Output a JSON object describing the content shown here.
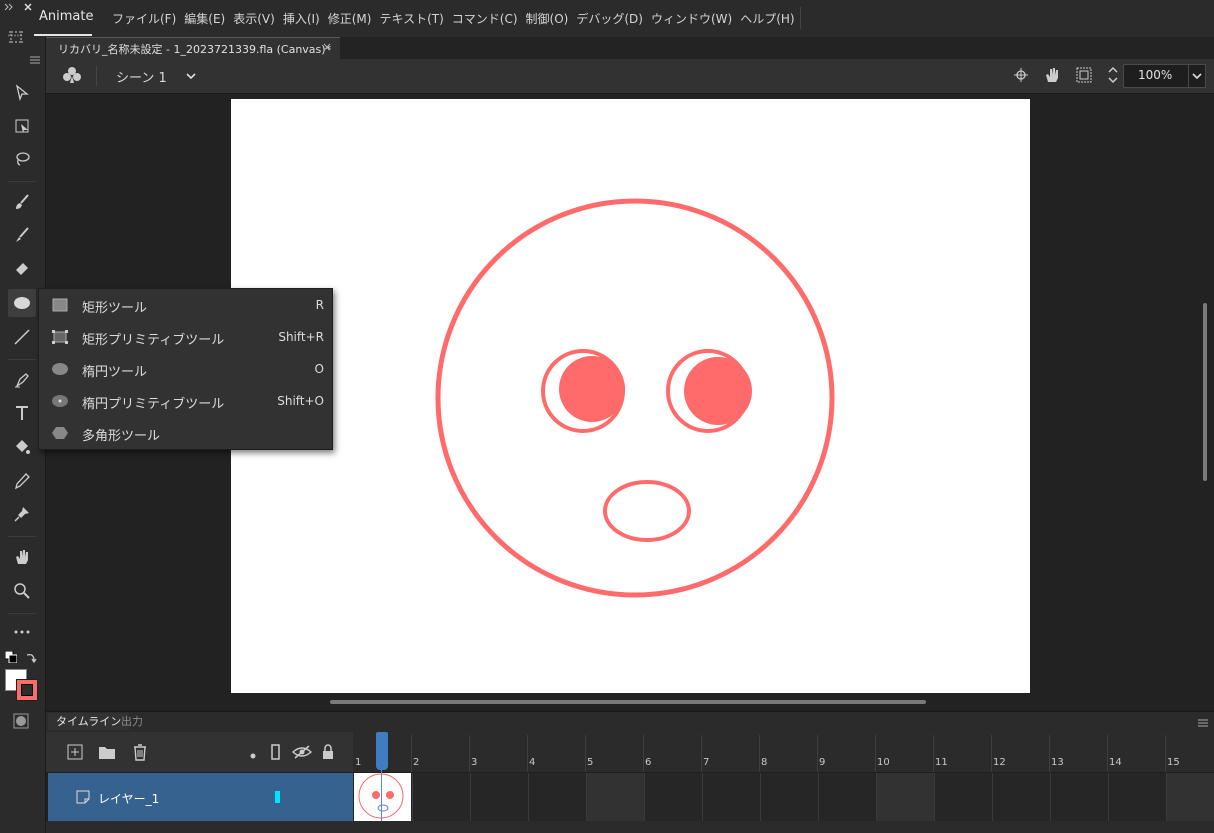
{
  "app": {
    "name": "Animate"
  },
  "menu": [
    "ファイル(F)",
    "編集(E)",
    "表示(V)",
    "挿入(I)",
    "修正(M)",
    "テキスト(T)",
    "コマンド(C)",
    "制御(O)",
    "デバッグ(D)",
    "ウィンドウ(W)",
    "ヘルプ(H)"
  ],
  "document": {
    "tab_label": "リカバリ_名称未設定 - 1_2023721339.fla (Canvas)*",
    "close": "×"
  },
  "scene": {
    "label": "シーン 1"
  },
  "zoom": {
    "value": "100%"
  },
  "colors": {
    "stroke": "#ff6b6b",
    "accent": "#3f7cc0",
    "layer_bg": "#35628f"
  },
  "flyout": {
    "items": [
      {
        "label": "矩形ツール",
        "shortcut": "R",
        "icon": "rectangle-icon"
      },
      {
        "label": "矩形プリミティブツール",
        "shortcut": "Shift+R",
        "icon": "rectangle-primitive-icon"
      },
      {
        "label": "楕円ツール",
        "shortcut": "O",
        "icon": "oval-icon"
      },
      {
        "label": "楕円プリミティブツール",
        "shortcut": "Shift+O",
        "icon": "oval-primitive-icon"
      },
      {
        "label": "多角形ツール",
        "shortcut": "",
        "icon": "polygon-icon"
      }
    ]
  },
  "timeline": {
    "tab": "タイムライン",
    "output_tab": "出力",
    "layer_name": "レイヤー_1",
    "frames": [
      "1",
      "2",
      "3",
      "4",
      "5",
      "6",
      "7",
      "8",
      "9",
      "10",
      "11",
      "12",
      "13",
      "14",
      "15"
    ]
  }
}
